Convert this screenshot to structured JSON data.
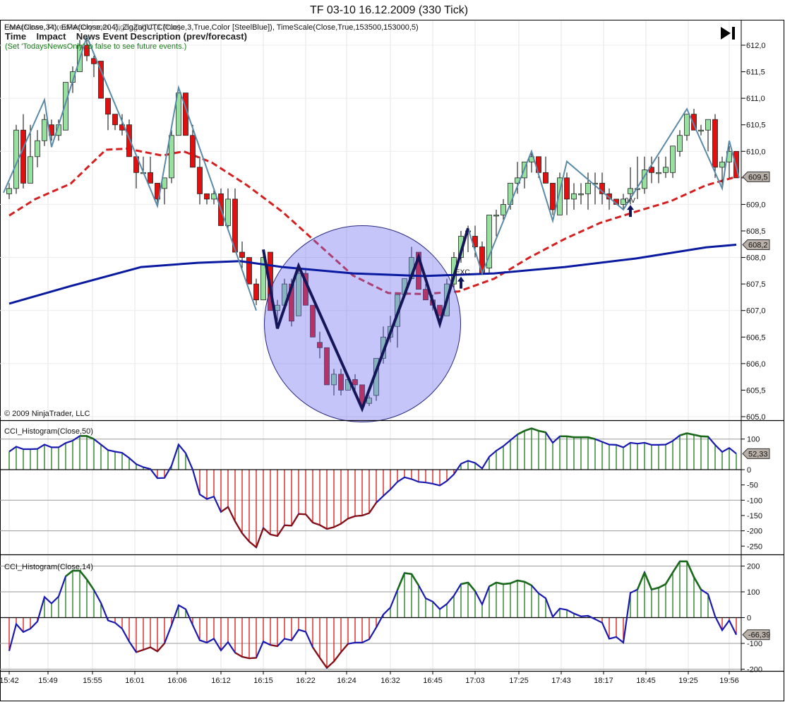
{
  "window": {
    "title": "TF 03-10  16.12.2009 (330 Tick)"
  },
  "header": {
    "indicators_line": "EMA(Close,34), EMA(Close,204), ZigZagUTC(Close,3,True,Color [SteelBlue]), TimeScale(Close,True,153500,153000,5)",
    "indicators_overlap": "ForexNews, ForexFactory.com, ZigZagUTC(3,True)",
    "news_columns": "Time    Impact    News Event Description (prev/forecast)",
    "news_hint": "(Set 'TodaysNewsOnly' to false to see future events.)",
    "copyright": "© 2009 NinjaTrader, LLC"
  },
  "controls": {
    "scroll_to_end_icon": "play-to-end-icon"
  },
  "colors": {
    "up": "#98e0a0",
    "down": "#e01010",
    "ema_fast": "#d42020",
    "ema_slow": "#0a1aa0",
    "zigzag": "#5a8aa8",
    "zigzag_bold": "#15155a",
    "circle": "#6e6ef0"
  },
  "chart_data": [
    {
      "type": "candlestick",
      "title": "Price",
      "ylim": [
        605.0,
        612.25
      ],
      "ytick_labels": [
        "612,0",
        "611,5",
        "611,0",
        "610,5",
        "610,0",
        "609,5",
        "609,0",
        "608,5",
        "608,0",
        "607,5",
        "607,0",
        "606,5",
        "606,0",
        "605,5",
        "605,0"
      ],
      "ytick_values": [
        612.0,
        611.5,
        611.0,
        610.5,
        610.0,
        609.5,
        609.0,
        608.5,
        608.0,
        607.5,
        607.0,
        606.5,
        606.0,
        605.5,
        605.0
      ],
      "ohlc": [
        [
          609.2,
          609.4,
          609.1,
          609.3
        ],
        [
          609.3,
          610.5,
          609.2,
          610.4
        ],
        [
          610.4,
          610.7,
          609.3,
          609.4
        ],
        [
          609.4,
          610.5,
          609.4,
          609.9
        ],
        [
          609.9,
          610.4,
          609.7,
          610.2
        ],
        [
          610.2,
          610.7,
          610.1,
          610.6
        ],
        [
          610.5,
          610.6,
          610.2,
          610.3
        ],
        [
          610.3,
          610.6,
          610.2,
          610.5
        ],
        [
          610.4,
          611.3,
          610.4,
          611.3
        ],
        [
          611.3,
          611.6,
          611.1,
          611.5
        ],
        [
          611.5,
          612.1,
          611.5,
          612.0
        ],
        [
          612.0,
          612.1,
          611.7,
          611.8
        ],
        [
          611.75,
          611.8,
          611.4,
          611.65
        ],
        [
          611.7,
          611.7,
          611.0,
          611.0
        ],
        [
          611.0,
          611.0,
          610.4,
          610.7
        ],
        [
          610.7,
          610.7,
          610.4,
          610.5
        ],
        [
          610.5,
          610.7,
          610.3,
          610.4
        ],
        [
          610.5,
          610.6,
          609.9,
          609.9
        ],
        [
          609.9,
          609.9,
          609.3,
          609.6
        ],
        [
          609.6,
          609.9,
          609.6,
          609.6
        ],
        [
          609.6,
          609.9,
          609.4,
          609.4
        ],
        [
          609.4,
          609.4,
          609.0,
          609.1
        ],
        [
          609.3,
          609.5,
          609.0,
          609.5
        ],
        [
          609.5,
          610.4,
          609.4,
          610.3
        ],
        [
          610.3,
          611.1,
          610.3,
          611.1
        ],
        [
          611.1,
          611.1,
          610.3,
          610.3
        ],
        [
          610.3,
          610.5,
          609.7,
          609.7
        ],
        [
          609.7,
          609.9,
          609.0,
          609.2
        ],
        [
          609.2,
          609.2,
          609.0,
          609.1
        ],
        [
          609.1,
          609.3,
          609.0,
          609.2
        ],
        [
          609.2,
          609.3,
          608.6,
          608.6
        ],
        [
          608.6,
          609.3,
          608.5,
          609.1
        ],
        [
          609.1,
          609.3,
          608.1,
          608.1
        ],
        [
          608.1,
          608.3,
          607.8,
          608.0
        ],
        [
          608.0,
          608.0,
          607.5,
          607.5
        ],
        [
          607.5,
          607.6,
          607.1,
          607.2
        ],
        [
          607.2,
          608.1,
          607.2,
          608.0
        ],
        [
          608.1,
          608.1,
          607.0,
          607.0
        ],
        [
          607.0,
          607.2,
          606.8,
          607.1
        ],
        [
          607.1,
          607.6,
          607.0,
          607.5
        ],
        [
          607.5,
          607.6,
          606.7,
          606.8
        ],
        [
          606.9,
          607.8,
          606.9,
          607.7
        ],
        [
          607.7,
          607.8,
          607.1,
          607.1
        ],
        [
          607.1,
          607.1,
          606.5,
          606.5
        ],
        [
          606.4,
          606.6,
          606.1,
          606.3
        ],
        [
          606.3,
          606.3,
          605.6,
          605.6
        ],
        [
          605.6,
          605.9,
          605.4,
          605.8
        ],
        [
          605.8,
          605.9,
          605.4,
          605.5
        ],
        [
          605.5,
          605.8,
          605.5,
          605.7
        ],
        [
          605.7,
          605.8,
          605.5,
          605.6
        ],
        [
          605.6,
          605.6,
          605.2,
          605.2
        ],
        [
          605.25,
          605.4,
          605.2,
          605.35
        ],
        [
          605.4,
          606.1,
          605.3,
          606.1
        ],
        [
          606.1,
          606.7,
          606.0,
          606.5
        ],
        [
          606.5,
          606.9,
          606.4,
          606.7
        ],
        [
          606.7,
          607.3,
          606.3,
          607.3
        ],
        [
          607.3,
          607.6,
          607.3,
          607.6
        ],
        [
          607.6,
          608.2,
          607.6,
          608.0
        ],
        [
          608.1,
          608.1,
          607.4,
          607.4
        ],
        [
          607.4,
          607.5,
          607.2,
          607.2
        ],
        [
          607.2,
          607.3,
          607.0,
          607.1
        ],
        [
          607.1,
          607.1,
          606.9,
          606.9
        ],
        [
          606.9,
          607.6,
          606.9,
          607.5
        ],
        [
          607.5,
          608.1,
          607.4,
          608.0
        ],
        [
          608.0,
          608.5,
          607.9,
          608.4
        ],
        [
          608.5,
          608.6,
          608.1,
          608.5
        ],
        [
          608.4,
          608.6,
          608.0,
          608.2
        ],
        [
          608.2,
          608.3,
          607.7,
          607.7
        ],
        [
          607.8,
          608.8,
          607.7,
          608.8
        ],
        [
          608.8,
          608.9,
          608.4,
          608.8
        ],
        [
          608.8,
          609.1,
          608.7,
          609.0
        ],
        [
          609.0,
          609.4,
          608.9,
          609.4
        ],
        [
          609.4,
          609.8,
          609.2,
          609.5
        ],
        [
          609.5,
          609.8,
          609.3,
          609.8
        ],
        [
          609.8,
          610.0,
          609.6,
          609.9
        ],
        [
          609.9,
          609.9,
          609.5,
          609.6
        ],
        [
          609.6,
          609.9,
          609.4,
          609.4
        ],
        [
          609.4,
          609.4,
          608.8,
          608.9
        ],
        [
          608.8,
          609.6,
          608.8,
          609.5
        ],
        [
          609.5,
          609.6,
          608.8,
          609.1
        ],
        [
          609.1,
          609.4,
          608.9,
          609.2
        ],
        [
          609.2,
          609.4,
          609.0,
          609.2
        ],
        [
          609.2,
          609.6,
          608.9,
          609.4
        ],
        [
          609.4,
          609.6,
          609.0,
          609.4
        ],
        [
          609.4,
          609.6,
          609.0,
          609.2
        ],
        [
          609.2,
          609.3,
          608.9,
          609.1
        ],
        [
          609.1,
          609.1,
          609.0,
          609.0
        ],
        [
          609.0,
          609.2,
          608.9,
          609.1
        ],
        [
          609.2,
          609.7,
          609.0,
          609.3
        ],
        [
          609.3,
          609.9,
          609.1,
          609.3
        ],
        [
          609.3,
          609.9,
          609.2,
          609.65
        ],
        [
          609.7,
          609.9,
          609.4,
          609.6
        ],
        [
          609.6,
          609.9,
          609.4,
          609.6
        ],
        [
          609.6,
          609.9,
          609.5,
          609.7
        ],
        [
          609.6,
          610.1,
          609.5,
          610.1
        ],
        [
          610.0,
          610.4,
          609.9,
          610.3
        ],
        [
          610.3,
          610.7,
          610.2,
          610.7
        ],
        [
          610.7,
          610.8,
          610.4,
          610.4
        ],
        [
          610.4,
          610.5,
          610.3,
          610.4
        ],
        [
          610.4,
          610.6,
          610.0,
          610.6
        ],
        [
          610.6,
          610.7,
          609.5,
          609.7
        ],
        [
          609.7,
          609.9,
          609.3,
          609.8
        ],
        [
          609.8,
          610.1,
          609.5,
          610.0
        ],
        [
          610.0,
          610.0,
          609.5,
          609.5
        ]
      ],
      "ema_fast": {
        "name": "EMA(Close,34)",
        "points": [
          [
            0,
            608.79
          ],
          [
            3.7,
            609.1
          ],
          [
            8.7,
            609.39
          ],
          [
            13.7,
            610.03
          ],
          [
            16.7,
            610.05
          ],
          [
            21.7,
            609.92
          ],
          [
            24.7,
            610.0
          ],
          [
            28.7,
            609.79
          ],
          [
            33.7,
            609.36
          ],
          [
            38.7,
            608.86
          ],
          [
            43.7,
            608.26
          ],
          [
            48.7,
            607.66
          ],
          [
            53.7,
            607.33
          ],
          [
            58.7,
            607.31
          ],
          [
            63.7,
            607.36
          ],
          [
            68.7,
            607.6
          ],
          [
            73.7,
            608.0
          ],
          [
            78.7,
            608.35
          ],
          [
            83.7,
            608.65
          ],
          [
            88.7,
            608.86
          ],
          [
            93.7,
            609.06
          ],
          [
            98.7,
            609.36
          ],
          [
            103,
            609.52
          ]
        ]
      },
      "ema_slow": {
        "name": "EMA(Close,204)",
        "points": [
          [
            0,
            607.13
          ],
          [
            8.7,
            607.46
          ],
          [
            18.7,
            607.82
          ],
          [
            26.7,
            607.9
          ],
          [
            32.7,
            607.93
          ],
          [
            38.7,
            607.82
          ],
          [
            48.7,
            607.7
          ],
          [
            58.7,
            607.65
          ],
          [
            68.7,
            607.7
          ],
          [
            78.7,
            607.82
          ],
          [
            88.7,
            607.98
          ],
          [
            98.7,
            608.19
          ],
          [
            103,
            608.24
          ]
        ]
      },
      "zigzag": [
        [
          [
            -0.8,
            609.22
          ],
          [
            5,
            610.97
          ],
          [
            6,
            610.08
          ],
          [
            11,
            612.16
          ],
          [
            21,
            608.97
          ],
          [
            24,
            611.2
          ],
          [
            35,
            607.0
          ]
        ],
        [
          [
            65,
            608.55
          ],
          [
            67,
            607.7
          ],
          [
            74,
            610.0
          ],
          [
            77,
            608.69
          ],
          [
            79,
            609.81
          ],
          [
            87,
            608.9
          ],
          [
            96,
            610.8
          ],
          [
            101,
            609.3
          ],
          [
            102,
            610.2
          ],
          [
            103.4,
            609.5
          ]
        ]
      ],
      "zigzag_bold": [
        [
          36,
          608.15
        ],
        [
          38,
          606.66
        ],
        [
          41,
          607.84
        ],
        [
          50,
          605.15
        ],
        [
          58,
          608.01
        ],
        [
          61,
          606.75
        ],
        [
          65,
          608.55
        ]
      ],
      "highlight_circle": {
        "center_bar": 50,
        "center_price": 606.75,
        "radius_price": 1.85
      },
      "annotations": [
        {
          "text": "EXC",
          "bar": 64,
          "price": 607.6,
          "arrow": "up"
        },
        {
          "text": "0/V",
          "bar": 88,
          "price": 608.95,
          "arrow": "up"
        }
      ],
      "price_markers": [
        {
          "label": "609,5",
          "price": 609.52,
          "kind": "ema_fast"
        },
        {
          "label": "608,2",
          "price": 608.24,
          "kind": "ema_slow"
        }
      ]
    },
    {
      "type": "bar",
      "title": "CCI_Histogram(Close,50)",
      "ylim": [
        -279,
        160
      ],
      "ytick_values": [
        100,
        0,
        -50,
        -100,
        -150,
        -200,
        -250
      ],
      "ytick_labels": [
        "100",
        "0",
        "-50",
        "-100",
        "-150",
        "-200",
        "-250"
      ],
      "gridlines": [
        100,
        -100,
        -200
      ],
      "last_label": "52,33",
      "values": [
        59,
        75,
        67,
        67,
        68,
        82,
        73,
        73,
        87,
        95,
        110,
        110,
        100,
        82,
        64,
        59,
        55,
        38,
        18,
        8,
        2,
        -28,
        -27,
        13,
        82,
        54,
        0,
        -81,
        -96,
        -88,
        -138,
        -122,
        -169,
        -208,
        -235,
        -254,
        -191,
        -212,
        -217,
        -182,
        -183,
        -145,
        -146,
        -173,
        -181,
        -194,
        -188,
        -177,
        -160,
        -152,
        -150,
        -142,
        -108,
        -86,
        -65,
        -40,
        -25,
        -31,
        -40,
        -42,
        -46,
        -52,
        -37,
        -15,
        19,
        29,
        22,
        4,
        42,
        62,
        77,
        96,
        115,
        127,
        135,
        127,
        122,
        88,
        109,
        109,
        106,
        106,
        106,
        100,
        91,
        82,
        81,
        73,
        88,
        85,
        88,
        81,
        81,
        82,
        94,
        112,
        119,
        114,
        109,
        108,
        81,
        58,
        71,
        52.33
      ]
    },
    {
      "type": "bar",
      "title": "CCI_Histogram(Close,14)",
      "ylim": [
        -207,
        244
      ],
      "ytick_values": [
        200,
        100,
        0,
        -100,
        -200
      ],
      "ytick_labels": [
        "200",
        "100",
        "0",
        "-100",
        "-200"
      ],
      "gridlines": [
        200,
        100,
        -100,
        -200
      ],
      "last_label": "-66,39",
      "values": [
        -129,
        -25,
        -56,
        -43,
        -15,
        80,
        55,
        82,
        160,
        182,
        182,
        148,
        107,
        57,
        -11,
        -20,
        -43,
        -93,
        -134,
        -125,
        -115,
        -131,
        -100,
        -29,
        48,
        33,
        -29,
        -88,
        -97,
        -82,
        -127,
        -95,
        -136,
        -152,
        -158,
        -156,
        -93,
        -106,
        -111,
        -82,
        -88,
        -47,
        -55,
        -115,
        -156,
        -195,
        -170,
        -134,
        -102,
        -97,
        -97,
        -84,
        -38,
        12,
        39,
        107,
        173,
        169,
        125,
        75,
        62,
        33,
        53,
        85,
        130,
        136,
        103,
        51,
        121,
        136,
        130,
        133,
        144,
        139,
        125,
        94,
        75,
        3,
        35,
        30,
        16,
        5,
        7,
        -6,
        -20,
        -82,
        -75,
        -97,
        96,
        109,
        175,
        109,
        116,
        130,
        175,
        218,
        218,
        157,
        109,
        91,
        5,
        -49,
        -11,
        -66.39
      ]
    }
  ],
  "time_axis": {
    "labels": [
      "15:42",
      "15:49",
      "15:55",
      "16:01",
      "16:06",
      "16:12",
      "16:15",
      "16:22",
      "16:24",
      "16:32",
      "16:45",
      "17:03",
      "17:25",
      "17:43",
      "18:17",
      "18:45",
      "19:25",
      "19:56"
    ],
    "bars": [
      0,
      5.5,
      11.8,
      17.8,
      23.8,
      30,
      36,
      42,
      47.8,
      54,
      60,
      66,
      72.2,
      78.2,
      84.2,
      90.2,
      96.2,
      102
    ]
  }
}
